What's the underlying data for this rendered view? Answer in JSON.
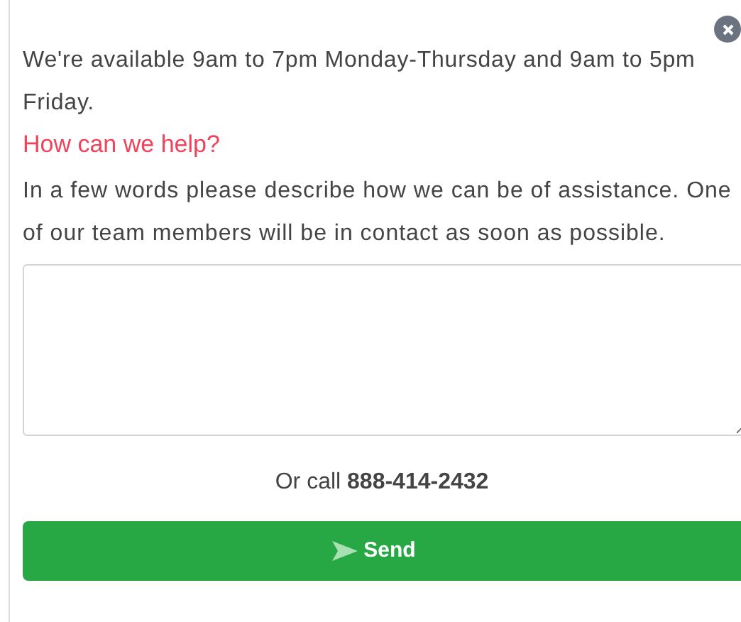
{
  "hours_text": "We're available 9am to 7pm Monday-Thursday and 9am to 5pm Friday.",
  "heading": "How can we help?",
  "description": "In a few words please describe how we can be of assistance. One of our team members will be in contact as soon as possible.",
  "message_field": {
    "kind": "textarea"
  },
  "call_text": "Or call **888-414-2432**",
  "send_button": {
    "label": "Send"
  }
}
